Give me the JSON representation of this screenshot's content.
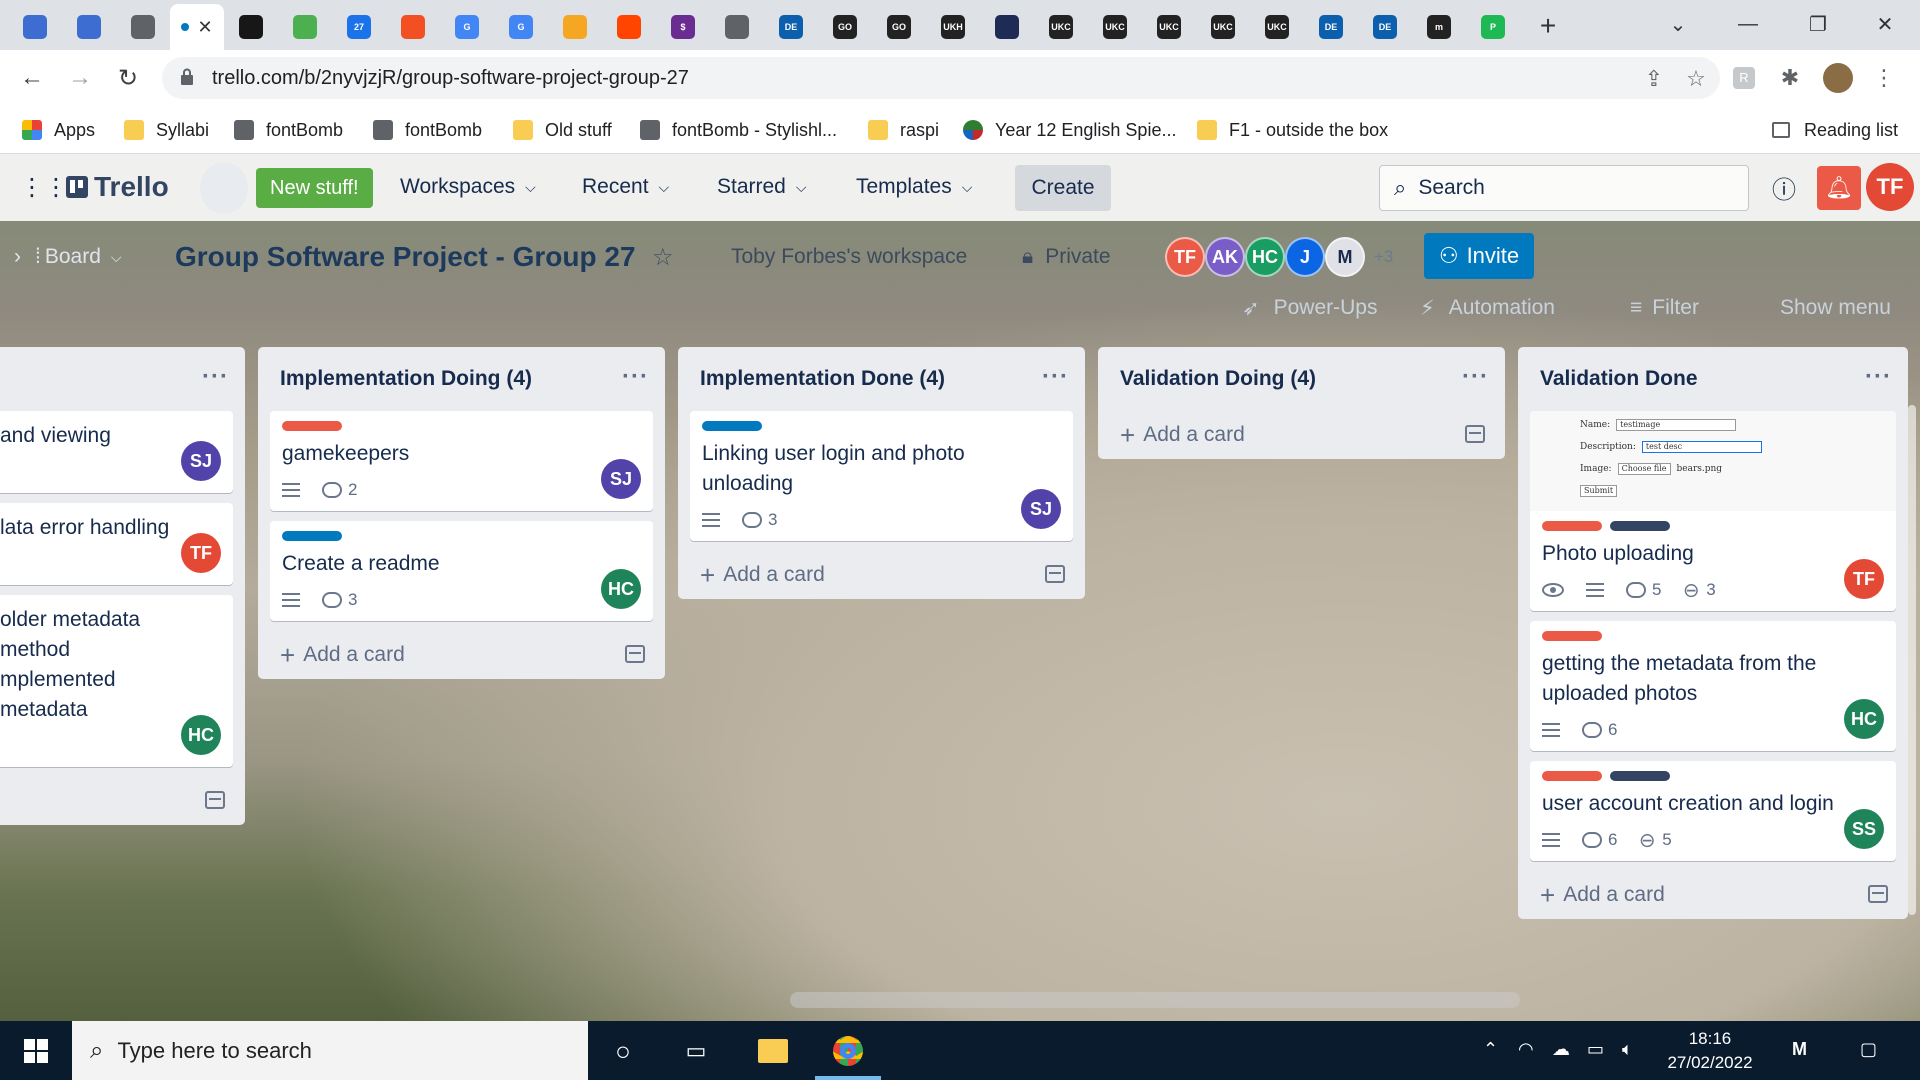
{
  "browser": {
    "tabs": [
      {
        "icon": "chevron-tab-icon",
        "label": "",
        "color": "#3d6dd1"
      },
      {
        "icon": "chevron-tab-icon",
        "label": "",
        "color": "#3d6dd1"
      },
      {
        "icon": "globe-icon",
        "label": "",
        "color": "#5f6368"
      },
      {
        "icon": "trello-tab-icon",
        "label": "",
        "color": "#0079bf"
      },
      {
        "icon": "github-icon",
        "label": "",
        "color": "#181717"
      },
      {
        "icon": "chrome-web-icon",
        "label": "",
        "color": "#4caf50"
      },
      {
        "icon": "calendar-icon",
        "label": "27",
        "color": "#1a73e8"
      },
      {
        "icon": "microsoft-icon",
        "label": "",
        "color": "#f25022"
      },
      {
        "icon": "google-icon",
        "label": "G",
        "color": "#4285f4"
      },
      {
        "icon": "google-icon",
        "label": "G",
        "color": "#4285f4"
      },
      {
        "icon": "weather-icon",
        "label": "",
        "color": "#f5a623"
      },
      {
        "icon": "reddit-icon",
        "label": "",
        "color": "#ff4500"
      },
      {
        "icon": "dollar-icon",
        "label": "$",
        "color": "#6a2c91"
      },
      {
        "icon": "globe-icon",
        "label": "",
        "color": "#5f6368"
      },
      {
        "icon": "de-icon",
        "label": "DE",
        "color": "#0b5fad"
      },
      {
        "icon": "go-icon",
        "label": "GO",
        "color": "#222"
      },
      {
        "icon": "go-icon",
        "label": "GO",
        "color": "#222"
      },
      {
        "icon": "ukh-icon",
        "label": "UKH",
        "color": "#222"
      },
      {
        "icon": "bird-icon",
        "label": "",
        "color": "#1e2b55"
      },
      {
        "icon": "ukc-icon",
        "label": "UKC",
        "color": "#222"
      },
      {
        "icon": "ukc-icon",
        "label": "UKC",
        "color": "#222"
      },
      {
        "icon": "ukc-icon",
        "label": "UKC",
        "color": "#222"
      },
      {
        "icon": "ukc-icon",
        "label": "UKC",
        "color": "#222"
      },
      {
        "icon": "ukc-icon",
        "label": "UKC",
        "color": "#222"
      },
      {
        "icon": "de-icon",
        "label": "DE",
        "color": "#0b5fad"
      },
      {
        "icon": "de-icon",
        "label": "DE",
        "color": "#0b5fad"
      },
      {
        "icon": "m-icon",
        "label": "m",
        "color": "#222"
      },
      {
        "icon": "p-icon",
        "label": "P",
        "color": "#1db954"
      }
    ],
    "url": "trello.com/b/2nyvjzjR/group-software-project-group-27",
    "bookmarks": [
      {
        "label": "Apps",
        "icon": "apps-grid-icon"
      },
      {
        "label": "Syllabi",
        "icon": "folder-icon"
      },
      {
        "label": "fontBomb",
        "icon": "globe-icon"
      },
      {
        "label": "fontBomb",
        "icon": "globe-icon"
      },
      {
        "label": "Old stuff",
        "icon": "folder-icon"
      },
      {
        "label": "fontBomb - Stylishl...",
        "icon": "globe-icon"
      },
      {
        "label": "raspi",
        "icon": "folder-icon"
      },
      {
        "label": "Year 12 English Spie...",
        "icon": "pinwheel-icon"
      },
      {
        "label": "F1 - outside the box",
        "icon": "folder-icon"
      }
    ],
    "reading_list": "Reading list"
  },
  "trello": {
    "logo": "Trello",
    "new_stuff": "New stuff!",
    "nav": [
      "Workspaces",
      "Recent",
      "Starred",
      "Templates"
    ],
    "create": "Create",
    "search_placeholder": "Search",
    "user_initials": "TF",
    "accent": "#0079bf",
    "notify_color": "#eb5a46"
  },
  "board": {
    "switcher": "Board",
    "title": "Group Software Project - Group 27",
    "workspace": "Toby Forbes's workspace",
    "visibility": "Private",
    "members": [
      {
        "initials": "TF",
        "color": "#eb5a46"
      },
      {
        "initials": "AK",
        "color": "#7a5ec8"
      },
      {
        "initials": "HC",
        "color": "#1a9d62"
      },
      {
        "initials": "J",
        "color": "#0c66e4"
      },
      {
        "initials": "M",
        "color": "#dfe1e6"
      }
    ],
    "more_members": "+3",
    "invite": "Invite",
    "power_ups": "Power-Ups",
    "automation": "Automation",
    "filter": "Filter",
    "show_menu": "Show menu",
    "add_card": "Add a card"
  },
  "lists": [
    {
      "title": "",
      "cards": [
        {
          "title": "and viewing",
          "labels": [],
          "badges": {},
          "member": {
            "initials": "SJ",
            "color": "#5243aa"
          }
        },
        {
          "title": "lata error handling",
          "labels": [],
          "badges": {},
          "member": {
            "initials": "TF",
            "color": "#e34935"
          }
        },
        {
          "title": "older metadata method mplemented metadata",
          "labels": [],
          "badges": {},
          "member": {
            "initials": "HC",
            "color": "#1f845a"
          }
        }
      ]
    },
    {
      "title": "Implementation Doing (4)",
      "cards": [
        {
          "title": "gamekeepers",
          "labels": [
            "#eb5a46"
          ],
          "badges": {
            "description": true,
            "comments": "2"
          },
          "member": {
            "initials": "SJ",
            "color": "#5243aa"
          }
        },
        {
          "title": "Create a readme",
          "labels": [
            "#0079bf"
          ],
          "badges": {
            "description": true,
            "comments": "3"
          },
          "member": {
            "initials": "HC",
            "color": "#1f845a"
          }
        }
      ]
    },
    {
      "title": "Implementation Done (4)",
      "cards": [
        {
          "title": "Linking user login and photo unloading",
          "labels": [
            "#0079bf"
          ],
          "badges": {
            "description": true,
            "comments": "3"
          },
          "member": {
            "initials": "SJ",
            "color": "#5243aa"
          }
        }
      ]
    },
    {
      "title": "Validation Doing (4)",
      "cards": []
    },
    {
      "title": "Validation Done",
      "cards": [
        {
          "title": "Photo uploading",
          "cover": {
            "name_label": "Name:",
            "name_value": "testimage",
            "desc_label": "Description:",
            "desc_value": "test desc",
            "image_label": "Image:",
            "choose_file": "Choose file",
            "file_name": "bears.png",
            "submit": "Submit"
          },
          "labels": [
            "#eb5a46",
            "#344563"
          ],
          "badges": {
            "watching": true,
            "description": true,
            "comments": "5",
            "attachments": "3"
          },
          "member": {
            "initials": "TF",
            "color": "#e34935"
          }
        },
        {
          "title": "getting the metadata from the uploaded photos",
          "labels": [
            "#eb5a46"
          ],
          "badges": {
            "description": true,
            "comments": "6"
          },
          "member": {
            "initials": "HC",
            "color": "#1f845a"
          }
        },
        {
          "title": "user account creation and login",
          "labels": [
            "#eb5a46",
            "#344563"
          ],
          "badges": {
            "description": true,
            "comments": "6",
            "attachments": "5"
          },
          "member": {
            "initials": "SS",
            "color": "#1f845a"
          }
        }
      ]
    }
  ],
  "taskbar": {
    "search_placeholder": "Type here to search",
    "time": "18:16",
    "date": "27/02/2022"
  }
}
